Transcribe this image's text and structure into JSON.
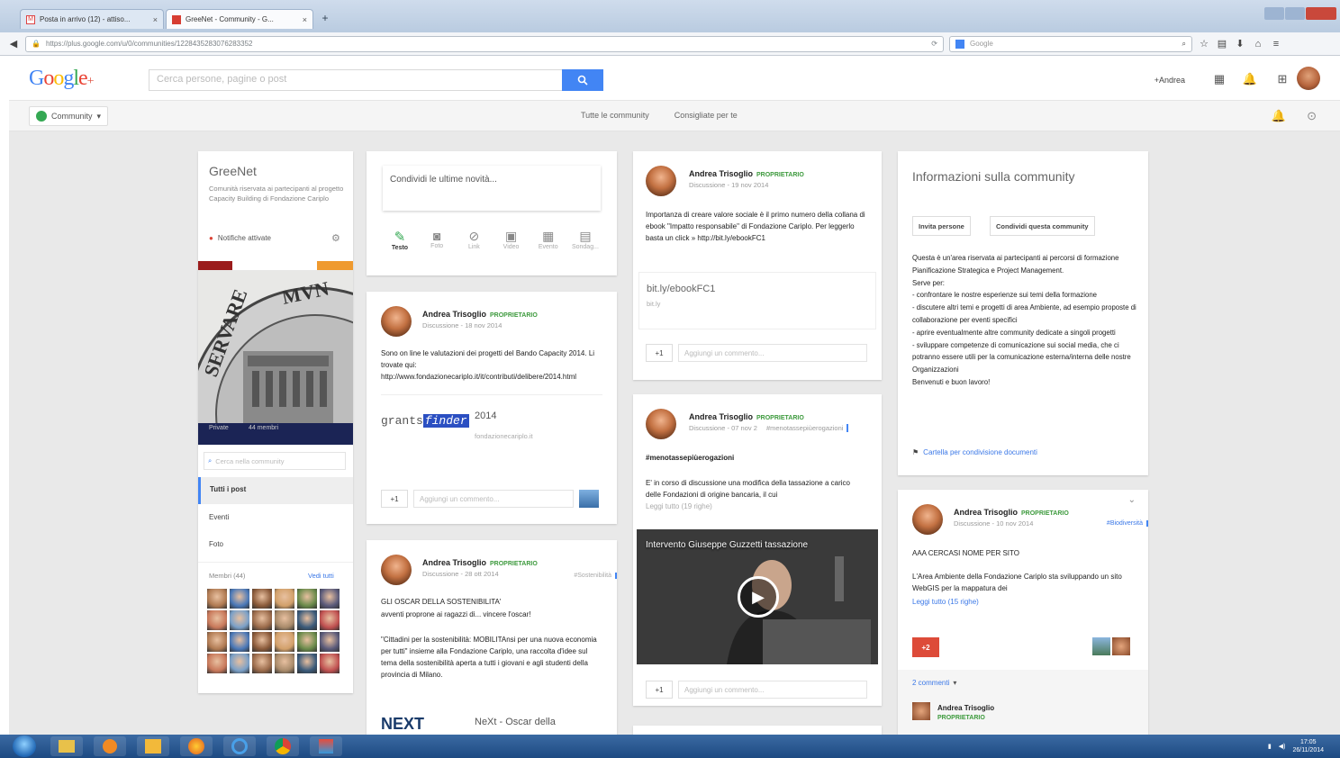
{
  "browser": {
    "tabs": [
      {
        "label": "Posta in arrivo (12) - attiso...",
        "active": false
      },
      {
        "label": "GreeNet - Community - G...",
        "active": true
      }
    ],
    "url": "https://plus.google.com/u/0/communities/1228435283076283352",
    "search_placeholder": "Google"
  },
  "gplus": {
    "logo": "Google+",
    "search_placeholder": "Cerca persone, pagine o post",
    "user": "+Andrea",
    "community_button": "Community",
    "subtabs": [
      "Tutte le community",
      "Consigliate per te"
    ]
  },
  "community": {
    "name": "GreeNet",
    "description": "Comunità riservata ai partecipanti al progetto Capacity Building di Fondazione Cariplo",
    "notifications": "Notifiche attivate",
    "search_placeholder": "Cerca nella community",
    "nav": [
      "Tutti i post",
      "Eventi",
      "Foto"
    ],
    "members_label": "Membri (44)",
    "see_all": "Vedi tutti",
    "coin_caption_left": "Private",
    "coin_caption_right": "44 membri"
  },
  "composer": {
    "placeholder": "Condividi le ultime novità...",
    "actions": [
      "Testo",
      "Foto",
      "Link",
      "Video",
      "Evento",
      "Sondag..."
    ]
  },
  "posts": [
    {
      "author": "Andrea Trisoglio",
      "role": "PROPRIETARIO",
      "meta": "Discussione - 18 nov 2014",
      "text": "Sono on line le valutazioni dei progetti del Bando Capacity 2014. Li trovate qui: http://www.fondazionecariplo.it/it/contributi/delibere/2014.html",
      "link_title": "2014",
      "link_domain": "fondazionecariplo.it",
      "link_logo": "grants",
      "link_logo_hl": "finder",
      "plus": "+1",
      "comment_placeholder": "Aggiungi un commento..."
    },
    {
      "author": "Andrea Trisoglio",
      "role": "PROPRIETARIO",
      "meta": "Discussione - 28 ott 2014",
      "tag": "#Sostenibilità",
      "text1": "GLI OSCAR DELLA SOSTENIBILITA'",
      "text2": "avventi proprone ai ragazzi di... vincere l'oscar!",
      "text3": "\"Cittadini per la sostenibilità: MOBILITAnsi per una nuova economia per tutti\" insieme alla Fondazione Cariplo, una raccolta d'idee sul tema della sostenibilità aperta a tutti i giovani e agli studenti della provincia di Milano.",
      "link_logo": "NEXT",
      "link_title": "NeXt - Oscar della"
    },
    {
      "author": "Andrea Trisoglio",
      "role": "PROPRIETARIO",
      "meta": "Discussione - 19 nov 2014",
      "text": "Importanza di creare valore sociale è il primo numero della collana di ebook \"Impatto responsabile\" di Fondazione Cariplo. Per leggerlo basta un click » http://bit.ly/ebookFC1",
      "link_title": "bit.ly/ebookFC1",
      "link_domain": "bit.ly",
      "plus": "+1",
      "comment_placeholder": "Aggiungi un commento..."
    },
    {
      "author": "Andrea Trisoglio",
      "role": "PROPRIETARIO",
      "meta": "Discussione - 07 nov 2",
      "tag": "#menotassepiùerogazioni",
      "hashtag": "#menotassepiùerogazioni",
      "text": "E' in corso di discussione una modifica della tassazione a carico delle Fondazioni di origine bancaria, il cui",
      "read_more": "Leggi tutto (19 righe)",
      "video_title": "Intervento Giuseppe Guzzetti tassazione",
      "plus": "+1",
      "comment_placeholder": "Aggiungi un commento..."
    },
    {
      "author": "Andrea Trisoglio",
      "role": "PROPRIETARIO",
      "meta": "Discussione - 10 nov 2014",
      "tag": "#Biodiversità",
      "text1": "AAA CERCASI NOME PER SITO",
      "text2": "L'Area Ambiente della Fondazione Cariplo sta sviluppando un sito WebGIS per la mappatura dei",
      "read_more": "Leggi tutto (15 righe)",
      "plus": "+2",
      "comments": "2 commenti",
      "commenter": "Andrea Trisoglio",
      "commenter_role": "PROPRIETARIO"
    }
  ],
  "about": {
    "title": "Informazioni sulla community",
    "invite": "Invita persone",
    "share": "Condividi questa community",
    "text": "Questa è un'area riservata ai partecipanti ai percorsi di formazione Pianificazione Strategica e Project Management.\nServe per:\n- confrontare le nostre esperienze sui temi della formazione\n- discutere altri temi e progetti di area Ambiente, ad esempio proposte di collaborazione per eventi specifici\n- aprire eventualmente altre community dedicate a singoli progetti\n- sviluppare competenze di comunicazione sui social media, che ci potranno essere utili per la comunicazione esterna/interna delle nostre Organizzazioni\nBenvenuti e buon lavoro!",
    "folder_link": "Cartella per condivisione documenti"
  },
  "taskbar": {
    "time": "17:05",
    "date": "26/11/2014"
  },
  "colors": {
    "accent": "#4285f4",
    "owner_green": "#3d9a3d",
    "plus_red": "#dd4b39",
    "background": "#e9e9e9"
  }
}
